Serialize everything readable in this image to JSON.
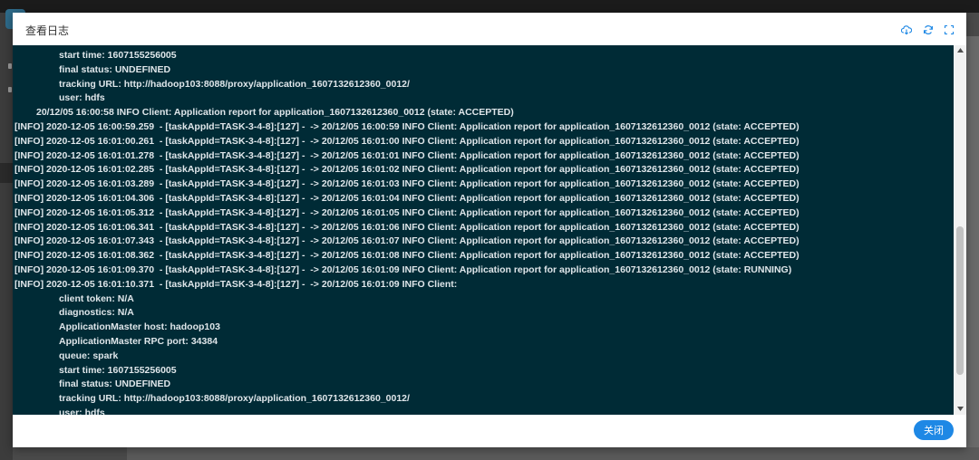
{
  "modal": {
    "title": "查看日志",
    "close_label": "关闭"
  },
  "icons": {
    "download": "cloud-download-icon",
    "refresh": "refresh-icon",
    "fullscreen": "fullscreen-icon"
  },
  "colors": {
    "log_background": "#002b36",
    "log_text": "#dfe6ea",
    "accent": "#1e88e5"
  },
  "log": {
    "lines": [
      {
        "indent": 2,
        "text": "start time: 1607155256005"
      },
      {
        "indent": 2,
        "text": "final status: UNDEFINED"
      },
      {
        "indent": 2,
        "text": "tracking URL: http://hadoop103:8088/proxy/application_1607132612360_0012/"
      },
      {
        "indent": 2,
        "text": "user: hdfs"
      },
      {
        "indent": 1,
        "text": "20/12/05 16:00:58 INFO Client: Application report for application_1607132612360_0012 (state: ACCEPTED)"
      },
      {
        "indent": 0,
        "text": "[INFO] 2020-12-05 16:00:59.259  - [taskAppId=TASK-3-4-8]:[127] -  -> 20/12/05 16:00:59 INFO Client: Application report for application_1607132612360_0012 (state: ACCEPTED)"
      },
      {
        "indent": 0,
        "text": "[INFO] 2020-12-05 16:01:00.261  - [taskAppId=TASK-3-4-8]:[127] -  -> 20/12/05 16:01:00 INFO Client: Application report for application_1607132612360_0012 (state: ACCEPTED)"
      },
      {
        "indent": 0,
        "text": "[INFO] 2020-12-05 16:01:01.278  - [taskAppId=TASK-3-4-8]:[127] -  -> 20/12/05 16:01:01 INFO Client: Application report for application_1607132612360_0012 (state: ACCEPTED)"
      },
      {
        "indent": 0,
        "text": "[INFO] 2020-12-05 16:01:02.285  - [taskAppId=TASK-3-4-8]:[127] -  -> 20/12/05 16:01:02 INFO Client: Application report for application_1607132612360_0012 (state: ACCEPTED)"
      },
      {
        "indent": 0,
        "text": "[INFO] 2020-12-05 16:01:03.289  - [taskAppId=TASK-3-4-8]:[127] -  -> 20/12/05 16:01:03 INFO Client: Application report for application_1607132612360_0012 (state: ACCEPTED)"
      },
      {
        "indent": 0,
        "text": "[INFO] 2020-12-05 16:01:04.306  - [taskAppId=TASK-3-4-8]:[127] -  -> 20/12/05 16:01:04 INFO Client: Application report for application_1607132612360_0012 (state: ACCEPTED)"
      },
      {
        "indent": 0,
        "text": "[INFO] 2020-12-05 16:01:05.312  - [taskAppId=TASK-3-4-8]:[127] -  -> 20/12/05 16:01:05 INFO Client: Application report for application_1607132612360_0012 (state: ACCEPTED)"
      },
      {
        "indent": 0,
        "text": "[INFO] 2020-12-05 16:01:06.341  - [taskAppId=TASK-3-4-8]:[127] -  -> 20/12/05 16:01:06 INFO Client: Application report for application_1607132612360_0012 (state: ACCEPTED)"
      },
      {
        "indent": 0,
        "text": "[INFO] 2020-12-05 16:01:07.343  - [taskAppId=TASK-3-4-8]:[127] -  -> 20/12/05 16:01:07 INFO Client: Application report for application_1607132612360_0012 (state: ACCEPTED)"
      },
      {
        "indent": 0,
        "text": "[INFO] 2020-12-05 16:01:08.362  - [taskAppId=TASK-3-4-8]:[127] -  -> 20/12/05 16:01:08 INFO Client: Application report for application_1607132612360_0012 (state: ACCEPTED)"
      },
      {
        "indent": 0,
        "text": "[INFO] 2020-12-05 16:01:09.370  - [taskAppId=TASK-3-4-8]:[127] -  -> 20/12/05 16:01:09 INFO Client: Application report for application_1607132612360_0012 (state: RUNNING)"
      },
      {
        "indent": 0,
        "text": "[INFO] 2020-12-05 16:01:10.371  - [taskAppId=TASK-3-4-8]:[127] -  -> 20/12/05 16:01:09 INFO Client:"
      },
      {
        "indent": 2,
        "text": "client token: N/A"
      },
      {
        "indent": 2,
        "text": "diagnostics: N/A"
      },
      {
        "indent": 2,
        "text": "ApplicationMaster host: hadoop103"
      },
      {
        "indent": 2,
        "text": "ApplicationMaster RPC port: 34384"
      },
      {
        "indent": 2,
        "text": "queue: spark"
      },
      {
        "indent": 2,
        "text": "start time: 1607155256005"
      },
      {
        "indent": 2,
        "text": "final status: UNDEFINED"
      },
      {
        "indent": 2,
        "text": "tracking URL: http://hadoop103:8088/proxy/application_1607132612360_0012/"
      },
      {
        "indent": 2,
        "text": "user: hdfs"
      }
    ]
  }
}
